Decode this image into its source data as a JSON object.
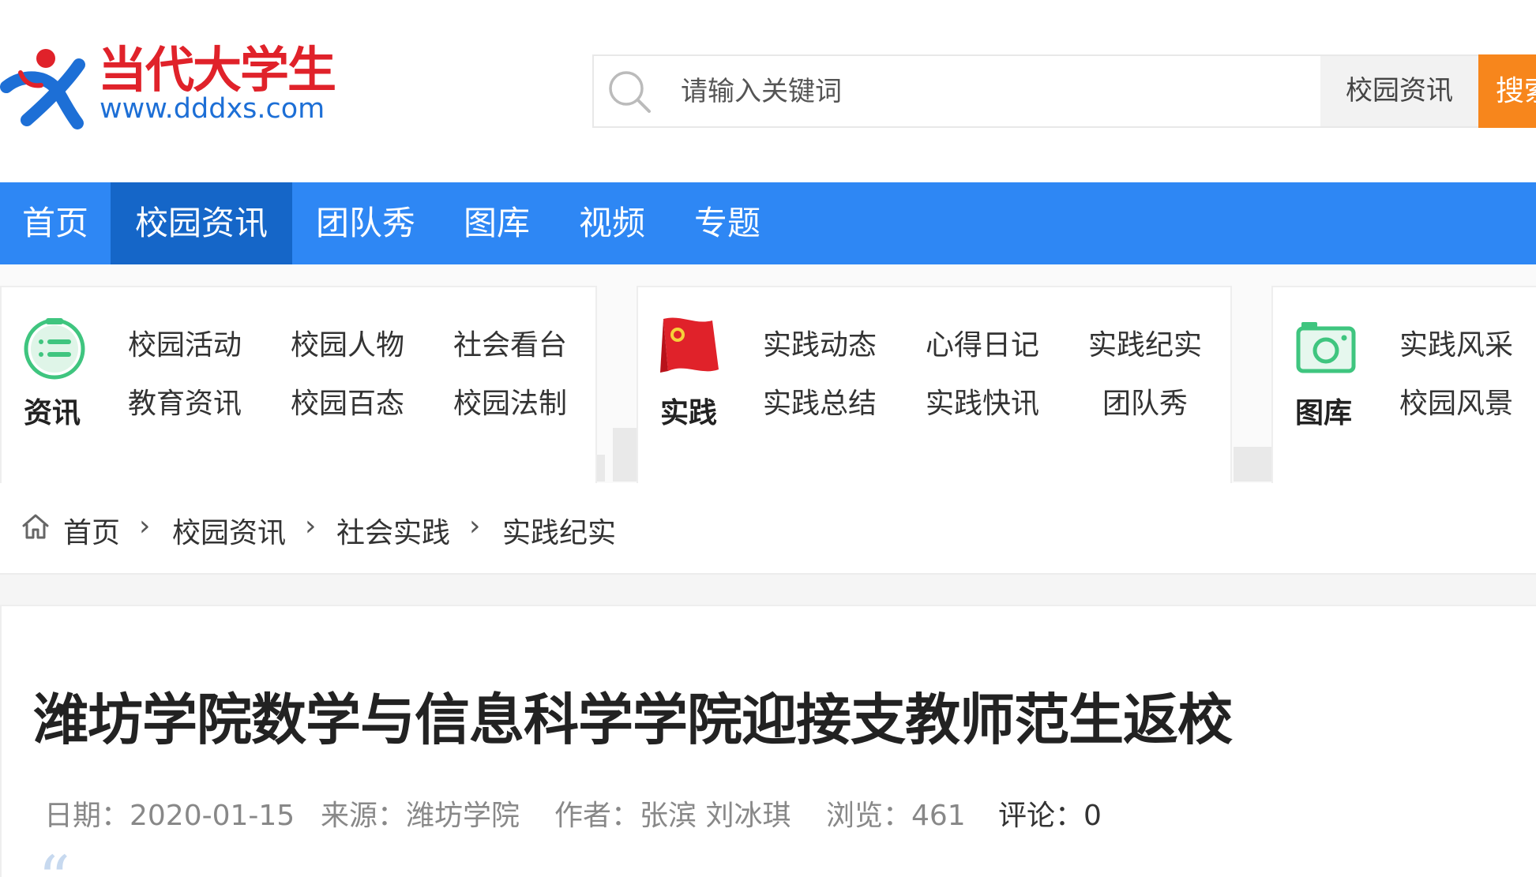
{
  "header": {
    "logo_cn": "当代大学生",
    "logo_url": "www.dddxs.com",
    "search": {
      "placeholder": "请输入关键词",
      "scope": "校园资讯",
      "button": "搜索"
    }
  },
  "nav": {
    "items": [
      "首页",
      "校园资讯",
      "团队秀",
      "图库",
      "视频",
      "专题"
    ],
    "active_index": 1
  },
  "submenu": [
    {
      "label": "资讯",
      "icon": "list-icon",
      "links": [
        "校园活动",
        "校园人物",
        "社会看台",
        "教育资讯",
        "校园百态",
        "校园法制"
      ]
    },
    {
      "label": "实践",
      "icon": "flag-icon",
      "links": [
        "实践动态",
        "心得日记",
        "实践纪实",
        "实践总结",
        "实践快讯",
        "团队秀"
      ]
    },
    {
      "label": "图库",
      "icon": "camera-icon",
      "links": [
        "实践风采",
        "校园风景"
      ]
    }
  ],
  "breadcrumb": [
    "首页",
    "校园资讯",
    "社会实践",
    "实践纪实"
  ],
  "article": {
    "title": "潍坊学院数学与信息科学学院迎接支教师范生返校",
    "meta": {
      "date": "日期：2020-01-15",
      "source": "来源：潍坊学院",
      "author": "作者：张滨 刘冰琪",
      "views": "浏览：461",
      "comments": "评论：0"
    }
  },
  "colors": {
    "nav_bg": "#2e87f4",
    "nav_active": "#1566c8",
    "search_button": "#f7861c",
    "logo_red": "#e0222a",
    "logo_blue": "#1d6fd6",
    "icon_green": "#3fc57f"
  }
}
